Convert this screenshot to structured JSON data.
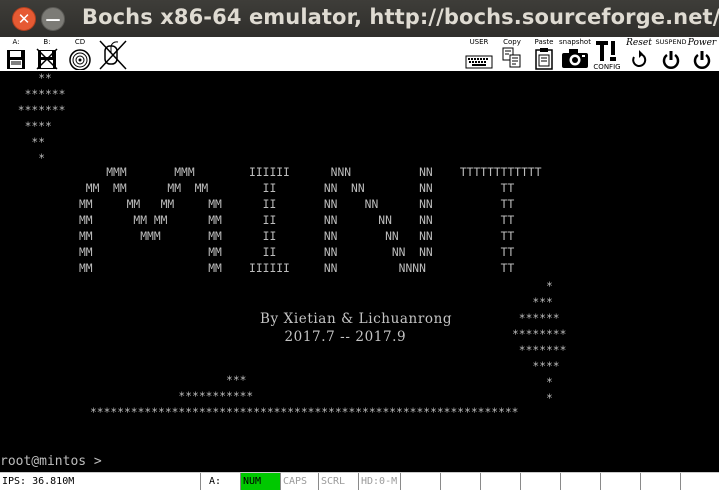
{
  "window": {
    "title": "Bochs x86-64 emulator, http://bochs.sourceforge.net/",
    "close_glyph": "✕",
    "minimize_glyph": "—"
  },
  "toolbar": {
    "left": [
      {
        "label": "A:",
        "icon": "floppy-a-icon"
      },
      {
        "label": "B:",
        "icon": "floppy-b-icon"
      },
      {
        "label": "CD",
        "icon": "cdrom-icon"
      },
      {
        "label": "",
        "icon": "mouse-icon"
      }
    ],
    "right": [
      {
        "label": "USER",
        "icon": "keyboard-icon"
      },
      {
        "label": "Copy",
        "icon": "copy-icon"
      },
      {
        "label": "Paste",
        "icon": "paste-icon"
      },
      {
        "label": "snapshot",
        "icon": "camera-icon"
      },
      {
        "label": "CONFIG",
        "icon": "config-icon"
      },
      {
        "label": "Reset",
        "icon": "reset-icon"
      },
      {
        "label": "SUSPEND",
        "icon": "suspend-icon"
      },
      {
        "label": "Power",
        "icon": "power-icon"
      }
    ]
  },
  "screen": {
    "stars_top": "    **\n  ******\n *******\n  ****\n   **\n    *",
    "banner": "         MMM       MMM        IIIIII      NNN          NN    TTTTTTTTTTTT\n      MM  MM      MM  MM        II       NN  NN        NN          TT\n     MM     MM   MM     MM      II       NN    NN      NN          TT\n     MM      MM MM      MM      II       NN      NN    NN          TT\n     MM       MMM       MM      II       NN       NN   NN          TT\n     MM                 MM      II       NN        NN  NN          TT\n     MM                 MM    IIIIII     NN         NNNN           TT",
    "credits": "By Xietian & Lichuanrong\n     2017.7 -- 2017.9",
    "stars_right": "     *\n   ***\n ******\n********\n *******\n   ****\n     *\n     *",
    "stars_bottom": "                    ***\n             ***********\n***************************************************************",
    "prompt": "root@mintos >"
  },
  "status": {
    "ips": "IPS: 36.810M",
    "drive": "A:",
    "num": "NUM",
    "caps": "CAPS",
    "scrl": "SCRL",
    "hd": "HD:0-M"
  },
  "colors": {
    "num_active": "#00c800",
    "terminal_fg": "#bdbdbd",
    "close_button": "#e65a33"
  }
}
